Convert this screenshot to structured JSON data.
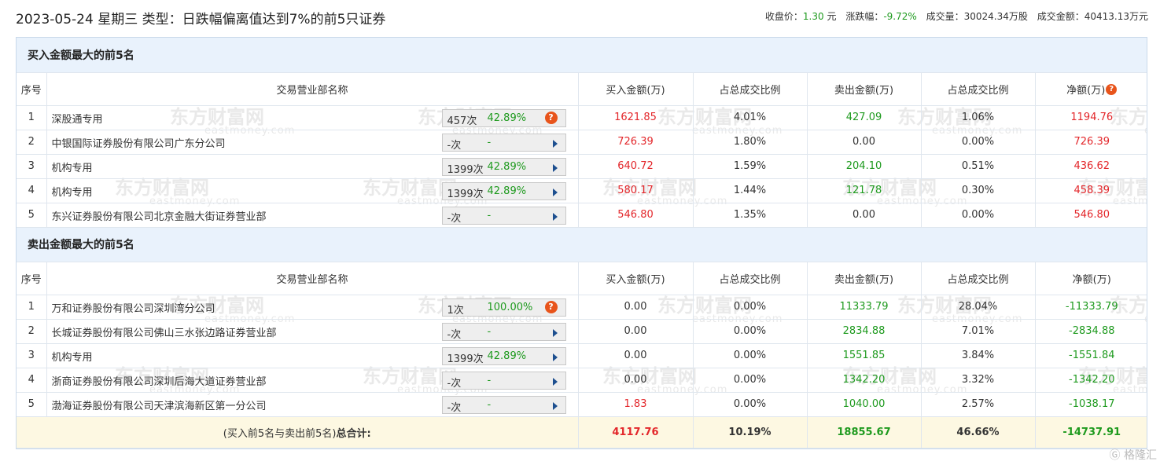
{
  "header": {
    "title": "2023-05-24 星期三 类型：日跌幅偏离值达到7%的前5只证券",
    "close_label": "收盘价：",
    "close_value": "1.30",
    "close_unit": "元",
    "change_label": "涨跌幅：",
    "change_value": "-9.72%",
    "volume_label": "成交量：",
    "volume_value": "30024.34万股",
    "amount_label": "成交金额：",
    "amount_value": "40413.13万元"
  },
  "columns": [
    "序号",
    "交易营业部名称",
    "买入金额(万)",
    "占总成交比例",
    "卖出金额(万)",
    "占总成交比例",
    "净额(万)"
  ],
  "buy_section": {
    "title": "买入金额最大的前5名",
    "rows": [
      {
        "idx": "1",
        "name": "深股通专用",
        "count": "457次",
        "pct": "42.89%",
        "icon": "question-icon",
        "buy": "1621.85",
        "buy_ratio": "4.01%",
        "sell": "427.09",
        "sell_ratio": "1.06%",
        "net": "1194.76"
      },
      {
        "idx": "2",
        "name": "中银国际证券股份有限公司广东分公司",
        "count": "-次",
        "pct": "-",
        "icon": "arrow-icon",
        "buy": "726.39",
        "buy_ratio": "1.80%",
        "sell": "0.00",
        "sell_ratio": "0.00%",
        "net": "726.39"
      },
      {
        "idx": "3",
        "name": "机构专用",
        "count": "1399次",
        "pct": "42.89%",
        "icon": "arrow-icon",
        "buy": "640.72",
        "buy_ratio": "1.59%",
        "sell": "204.10",
        "sell_ratio": "0.51%",
        "net": "436.62"
      },
      {
        "idx": "4",
        "name": "机构专用",
        "count": "1399次",
        "pct": "42.89%",
        "icon": "arrow-icon",
        "buy": "580.17",
        "buy_ratio": "1.44%",
        "sell": "121.78",
        "sell_ratio": "0.30%",
        "net": "458.39"
      },
      {
        "idx": "5",
        "name": "东兴证券股份有限公司北京金融大街证券营业部",
        "count": "-次",
        "pct": "-",
        "icon": "arrow-icon",
        "buy": "546.80",
        "buy_ratio": "1.35%",
        "sell": "0.00",
        "sell_ratio": "0.00%",
        "net": "546.80"
      }
    ]
  },
  "sell_section": {
    "title": "卖出金额最大的前5名",
    "rows": [
      {
        "idx": "1",
        "name": "万和证券股份有限公司深圳湾分公司",
        "count": "1次",
        "pct": "100.00%",
        "icon": "question-icon",
        "buy": "0.00",
        "buy_ratio": "0.00%",
        "sell": "11333.79",
        "sell_ratio": "28.04%",
        "net": "-11333.79"
      },
      {
        "idx": "2",
        "name": "长城证券股份有限公司佛山三水张边路证券营业部",
        "count": "-次",
        "pct": "-",
        "icon": "arrow-icon",
        "buy": "0.00",
        "buy_ratio": "0.00%",
        "sell": "2834.88",
        "sell_ratio": "7.01%",
        "net": "-2834.88"
      },
      {
        "idx": "3",
        "name": "机构专用",
        "count": "1399次",
        "pct": "42.89%",
        "icon": "arrow-icon",
        "buy": "0.00",
        "buy_ratio": "0.00%",
        "sell": "1551.85",
        "sell_ratio": "3.84%",
        "net": "-1551.84"
      },
      {
        "idx": "4",
        "name": "浙商证券股份有限公司深圳后海大道证券营业部",
        "count": "-次",
        "pct": "-",
        "icon": "arrow-icon",
        "buy": "0.00",
        "buy_ratio": "0.00%",
        "sell": "1342.20",
        "sell_ratio": "3.32%",
        "net": "-1342.20"
      },
      {
        "idx": "5",
        "name": "渤海证券股份有限公司天津滨海新区第一分公司",
        "count": "-次",
        "pct": "-",
        "icon": "arrow-icon",
        "buy": "1.83",
        "buy_ratio": "0.00%",
        "sell": "1040.00",
        "sell_ratio": "2.57%",
        "net": "-1038.17"
      }
    ]
  },
  "total": {
    "label_prefix": "(买入前5名与卖出前5名)",
    "label_bold": "总合计:",
    "buy": "4117.76",
    "buy_ratio": "10.19%",
    "sell": "18855.67",
    "sell_ratio": "46.66%",
    "net": "-14737.91"
  },
  "watermark": {
    "cn": "东方财富网",
    "en": "eastmoney.com"
  },
  "corner_logo": "格隆汇",
  "colors": {
    "red": "#e3262a",
    "green": "#1e9a1e",
    "section_bg": "#e9f2fc",
    "total_bg": "#fdf8e2",
    "question_icon": "#e8541b",
    "arrow_icon": "#1d4f8f"
  }
}
